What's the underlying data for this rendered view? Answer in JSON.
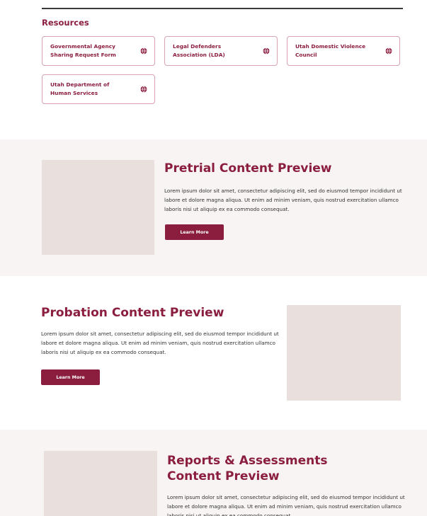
{
  "resources": {
    "heading": "Resources",
    "links": [
      {
        "label": "Governmental Agency Sharing Request Form",
        "icon": "globe-icon"
      },
      {
        "label": "Legal Defenders Association (LDA)",
        "icon": "globe-icon"
      },
      {
        "label": "Utah Domestic Violence Council",
        "icon": "globe-icon"
      },
      {
        "label": "Utah Department of Human Services",
        "icon": "globe-icon"
      }
    ]
  },
  "sections": [
    {
      "title": "Pretrial Content Preview",
      "body": "Lorem ipsum dolor sit amet, consectetur adipiscing elit, sed do eiusmod tempor incididunt ut labore et dolore magna aliqua. Ut enim ad minim veniam, quis nostrud exercitation ullamco laboris nisi ut aliquip ex ea commodo consequat.",
      "button": "Learn More"
    },
    {
      "title": "Probation Content Preview",
      "body": "Lorem ipsum dolor sit amet, consectetur adipiscing elit, sed do eiusmod tempor incididunt ut labore et dolore magna aliqua. Ut enim ad minim veniam, quis nostrud exercitation ullamco laboris nisi ut aliquip ex ea commodo consequat.",
      "button": "Learn More"
    },
    {
      "title": "Reports & Assessments Content Preview",
      "body": "Lorem ipsum dolor sit amet, consectetur adipiscing elit, sed do eiusmod tempor incididunt ut labore et dolore magna aliqua. Ut enim ad minim veniam, quis nostrud exercitation ullamco laboris nisi ut aliquip ex ea commodo consequat."
    }
  ],
  "colors": {
    "brand": "#8b1e3f",
    "band_background": "#f7f4f3",
    "image_placeholder": "#e9e0dd"
  }
}
